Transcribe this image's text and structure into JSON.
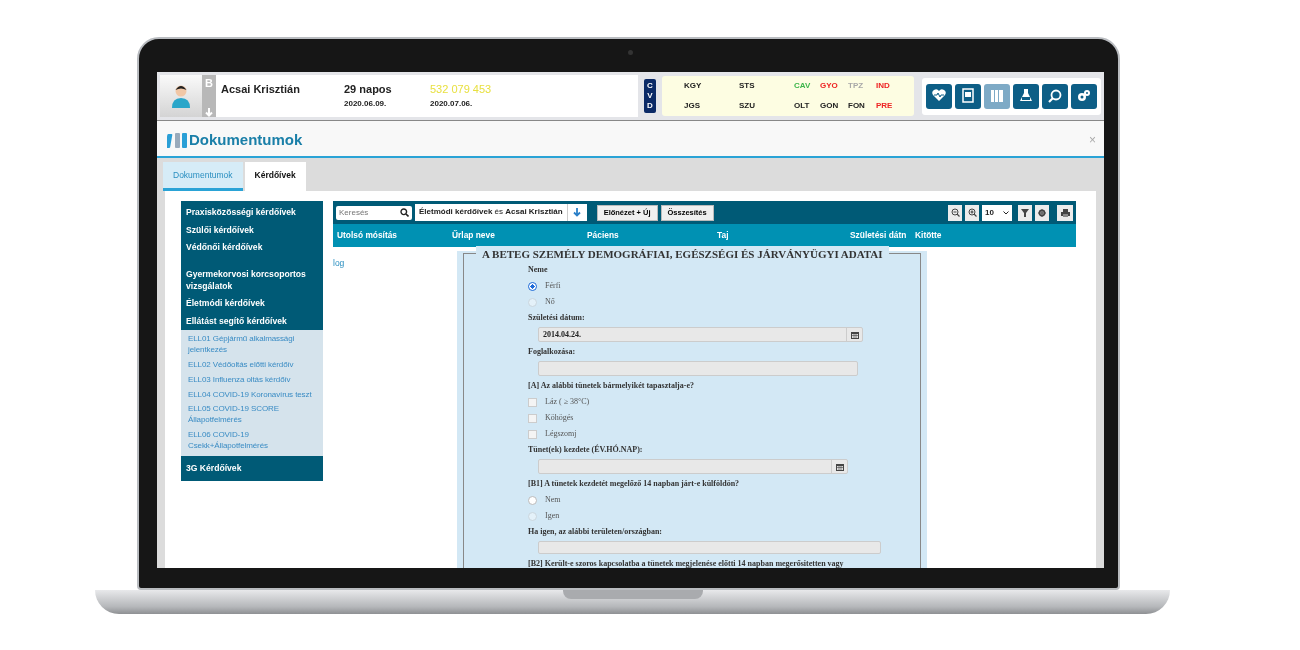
{
  "header": {
    "badge": "B",
    "patient_name": "Acsai Krisztián",
    "age": "29 napos",
    "birth_date": "2020.06.09.",
    "taj": "532 079 453",
    "date": "2020.07.06.",
    "cvd": "CVD",
    "codes": [
      {
        "text": "KGY",
        "color": "#222222"
      },
      {
        "text": "STS",
        "color": "#222222"
      },
      {
        "text": "CAV",
        "color": "#3cb54a"
      },
      {
        "text": "GYO",
        "color": "#ee2222"
      },
      {
        "text": "TPZ",
        "color": "#a8a8a8"
      },
      {
        "text": "IND",
        "color": "#ee2222"
      },
      {
        "text": "JGS",
        "color": "#222222"
      },
      {
        "text": "SZU",
        "color": "#222222"
      },
      {
        "text": "OLT",
        "color": "#222222"
      },
      {
        "text": "GON",
        "color": "#222222"
      },
      {
        "text": "FON",
        "color": "#222222"
      },
      {
        "text": "PRE",
        "color": "#ee2222"
      }
    ],
    "tool_buttons": [
      {
        "selected": false
      },
      {
        "selected": false
      },
      {
        "selected": true
      },
      {
        "selected": false
      },
      {
        "selected": false
      },
      {
        "selected": false
      }
    ]
  },
  "modal": {
    "title": "Dokumentumok",
    "close": "×",
    "tabs": [
      {
        "label": "Dokumentumok",
        "selected": false
      },
      {
        "label": "Kérdőívek",
        "selected": true
      }
    ]
  },
  "sidebar": {
    "items": [
      {
        "label": "Praxisközösségi kérdőívek"
      },
      {
        "label": "Szülői kérdőívek"
      },
      {
        "label": "Védőnői kérdőívek"
      },
      {
        "label": "Gyermekorvosi korcsoportos vizsgálatok"
      },
      {
        "label": "Életmódi kérdőívek"
      },
      {
        "label": "Ellátást segítő kérdőívek",
        "children": [
          {
            "label": "ELL01 Gépjármű alkalmassági jelentkezés"
          },
          {
            "label": "ELL02 Védőoltás előtti kérdőív"
          },
          {
            "label": "ELL03 Influenza oltás kérdőív"
          },
          {
            "label": "ELL04 COVID-19 Koronavírus teszt"
          },
          {
            "label": "ELL05 COVID-19 SCORE Állapotfelmérés"
          },
          {
            "label": "ELL06 COVID-19 Csekk+Állapotfelmérés"
          }
        ]
      },
      {
        "label": "3G Kérdőívek"
      }
    ]
  },
  "table": {
    "search": {
      "placeholder": "Keresés"
    },
    "filter": "**Életmódi kérdőívek** és **Acsai Krisztián**",
    "buttons": [
      "Előnézet + Új",
      "Összesítés"
    ],
    "page_size": "10",
    "columns": [
      "Utolsó mósítás",
      "Űrlap neve",
      "Páciens",
      "Taj",
      "Születési dátn",
      "Kitötte"
    ],
    "rows": [
      {
        "link": "log"
      }
    ]
  },
  "form": {
    "title": "A BETEG SZEMÉLY DEMOGRÁFIAI, EGÉSZSÉGI ÉS JÁRVÁNYÜGYI ADATAI",
    "fields": [
      {
        "kind": "label",
        "text": "Neme"
      },
      {
        "kind": "radio",
        "text": "Férfi",
        "checked": true,
        "disabled": false
      },
      {
        "kind": "radio",
        "text": "Nő",
        "checked": false,
        "disabled": true
      },
      {
        "kind": "label",
        "text": "Születési dátum:"
      },
      {
        "kind": "date",
        "value": "2014.04.24."
      },
      {
        "kind": "label",
        "text": "Foglalkozása:"
      },
      {
        "kind": "input"
      },
      {
        "kind": "label",
        "text": "[A] Az alábbi tünetek bármelyikét tapasztalja-e?"
      },
      {
        "kind": "checkbox",
        "text": "Láz ( ≥ 38°C)",
        "checked": false
      },
      {
        "kind": "checkbox",
        "text": "Köhögés",
        "checked": false
      },
      {
        "kind": "checkbox",
        "text": "Légszomj",
        "checked": false
      },
      {
        "kind": "label",
        "text": "Tünet(ek) kezdete (ÉV.HÓ.NAP):"
      },
      {
        "kind": "date"
      },
      {
        "kind": "label",
        "text": "[B1] A tünetek kezdetét megelőző 14 napban járt-e külföldön?"
      },
      {
        "kind": "radio",
        "text": "Nem",
        "checked": false,
        "disabled": false
      },
      {
        "kind": "radio",
        "text": "Igen",
        "checked": false,
        "disabled": true
      },
      {
        "kind": "label",
        "text": "Ha igen, az alábbi területen/országban:"
      },
      {
        "kind": "textarea"
      },
      {
        "kind": "label",
        "text": "[B2] Került-e szoros kapcsolatba a tünetek megjelenése előtti 14 napban megerősitetten vagy"
      }
    ]
  }
}
